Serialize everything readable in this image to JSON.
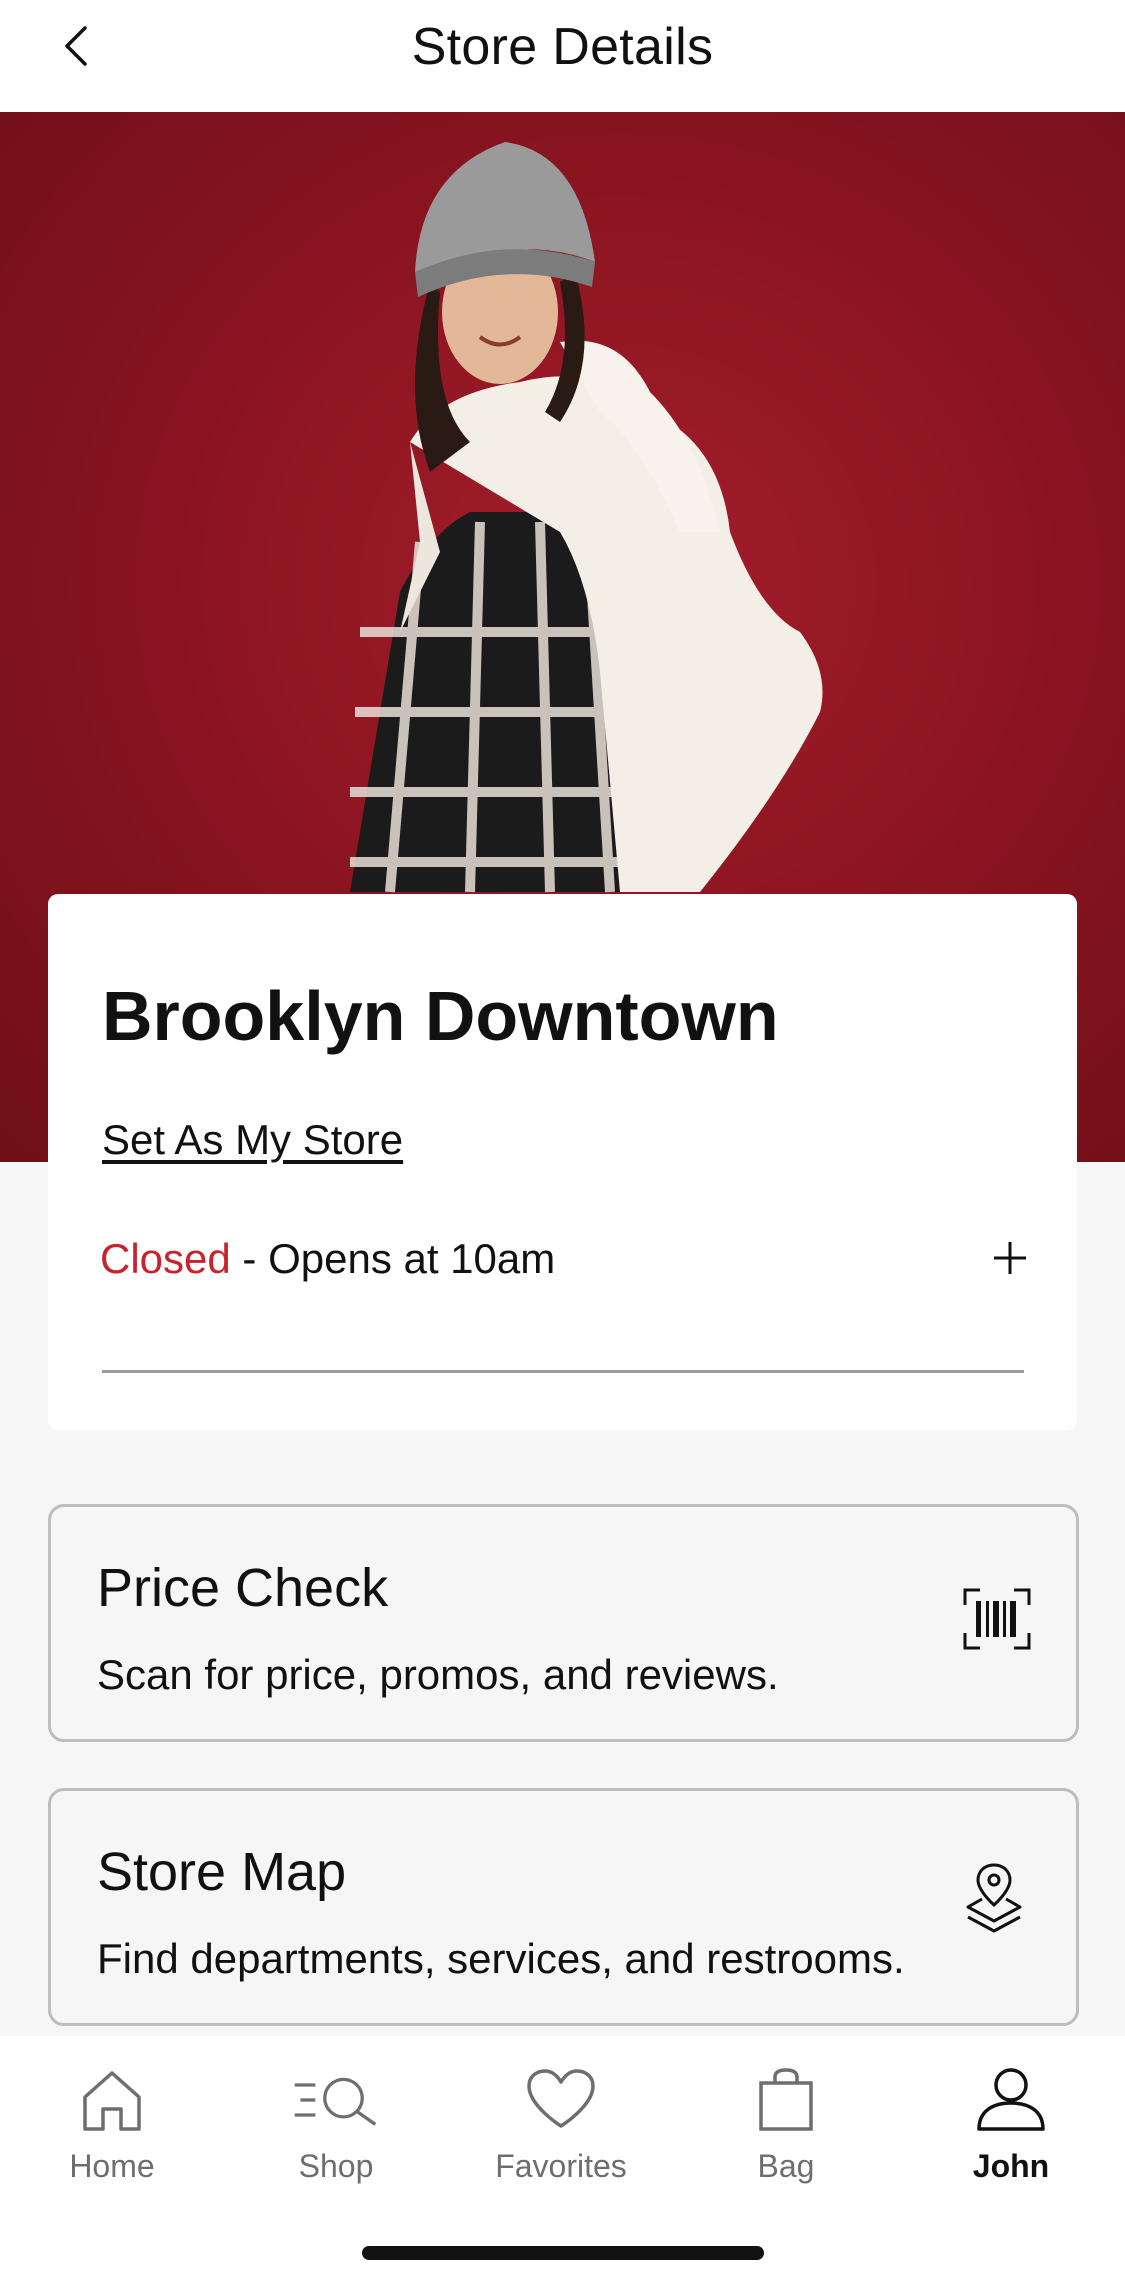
{
  "header": {
    "title": "Store Details"
  },
  "store": {
    "name": "Brooklyn Downtown",
    "set_store_label": "Set As My Store",
    "status": "Closed",
    "hours_text": "- Opens at 10am"
  },
  "tiles": [
    {
      "title": "Price Check",
      "subtitle": "Scan for price, promos, and reviews.",
      "icon": "barcode-scan-icon"
    },
    {
      "title": "Store Map",
      "subtitle": "Find departments, services, and restrooms.",
      "icon": "map-pin-layers-icon"
    }
  ],
  "nav": {
    "items": [
      {
        "label": "Home",
        "icon": "home-icon"
      },
      {
        "label": "Shop",
        "icon": "shop-search-icon"
      },
      {
        "label": "Favorites",
        "icon": "heart-icon"
      },
      {
        "label": "Bag",
        "icon": "bag-icon"
      },
      {
        "label": "John",
        "icon": "person-icon",
        "active": true
      }
    ]
  },
  "colors": {
    "accent_red": "#c8232c",
    "hero_bg": "#8c1521"
  }
}
